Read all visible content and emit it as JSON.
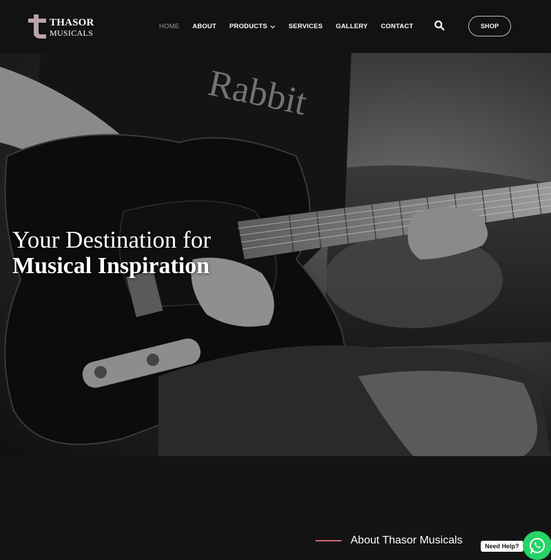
{
  "brand": {
    "logo_line1": "THASOR",
    "logo_line2": "MUSICALS",
    "logo_mark": "t",
    "logo_accent": "#b9a3a6"
  },
  "nav": {
    "items": [
      {
        "label": "HOME",
        "active": true
      },
      {
        "label": "ABOUT",
        "active": false
      },
      {
        "label": "PRODUCTS",
        "active": false,
        "has_dropdown": true
      },
      {
        "label": "SERVICES",
        "active": false
      },
      {
        "label": "GALLERY",
        "active": false
      },
      {
        "label": "CONTACT",
        "active": false
      }
    ],
    "search_icon": "search-icon",
    "shop_label": "SHOP"
  },
  "hero": {
    "title_line1": "Your Destination for",
    "title_line2": "Musical Inspiration",
    "image": "black-and-white photo of a person playing an electric guitar"
  },
  "about": {
    "heading": "About Thasor Musicals",
    "accent_color": "#d46a6a"
  },
  "help": {
    "label": "Need Help?",
    "whatsapp_icon": "whatsapp-icon",
    "whatsapp_color": "#25d366"
  }
}
